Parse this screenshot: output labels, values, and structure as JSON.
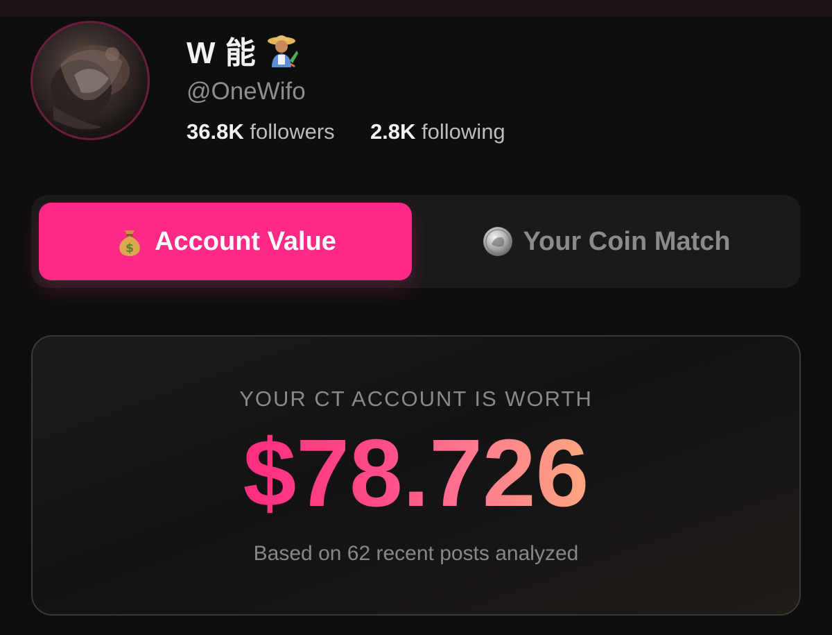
{
  "profile": {
    "display_name": "W 能",
    "name_emoji_icon": "farmer-icon",
    "handle": "@OneWifo",
    "followers_count": "36.8K",
    "followers_label": "followers",
    "following_count": "2.8K",
    "following_label": "following"
  },
  "tabs": [
    {
      "label": "Account Value",
      "icon": "moneybag-icon",
      "active": true
    },
    {
      "label": "Your Coin Match",
      "icon": "coin-icon",
      "active": false
    }
  ],
  "result": {
    "heading": "YOUR CT ACCOUNT IS WORTH",
    "value": "$78.726",
    "subtext": "Based on 62 recent posts analyzed"
  },
  "colors": {
    "accent": "#ff2a85",
    "background": "#0f0e0f",
    "value_gradient_start": "#ff2d7f",
    "value_gradient_end": "#ffa77f"
  }
}
